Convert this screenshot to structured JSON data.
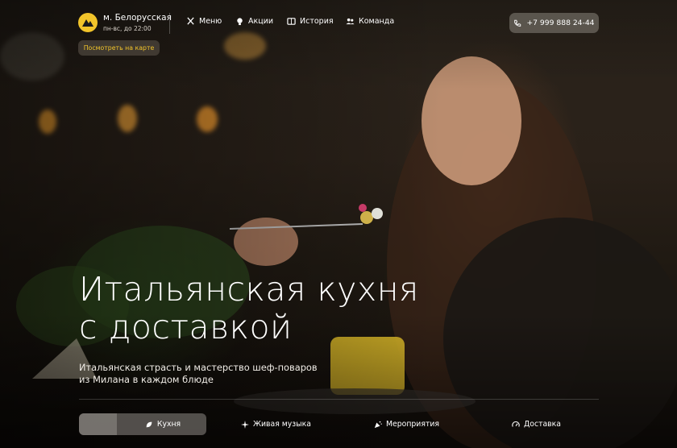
{
  "header": {
    "station": "м. Белорусская",
    "hours": "пн-вс, до 22:00",
    "map_button": "Посмотреть на карте",
    "nav": [
      {
        "label": "Меню",
        "icon": "utensils-icon"
      },
      {
        "label": "Акции",
        "icon": "bulb-icon"
      },
      {
        "label": "История",
        "icon": "book-icon"
      },
      {
        "label": "Команда",
        "icon": "team-icon"
      }
    ],
    "phone": "+7 999 888 24-44"
  },
  "hero": {
    "title_line1": "Итальянская кухня",
    "title_line2": "с доставкой",
    "subtitle_line1": "Итальянская страсть и мастерство шеф-поваров",
    "subtitle_line2": "из Милана в каждом блюде"
  },
  "tabs": [
    {
      "label": "Кухня",
      "icon": "leaf-icon",
      "active": true,
      "progress": 0.3
    },
    {
      "label": "Живая музыка",
      "icon": "sparkles-icon",
      "active": false
    },
    {
      "label": "Мероприятия",
      "icon": "party-icon",
      "active": false
    },
    {
      "label": "Доставка",
      "icon": "speedometer-icon",
      "active": false
    }
  ],
  "colors": {
    "accent": "#f2c42a",
    "logo_bg": "#f2c42a"
  }
}
